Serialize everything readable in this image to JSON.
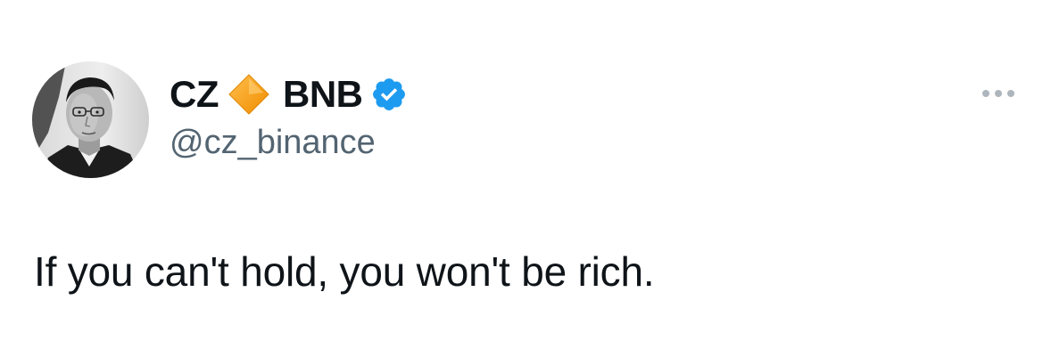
{
  "author": {
    "name": "CZ",
    "name_suffix": "BNB",
    "handle": "@cz_binance",
    "name_emoji": "orange-diamond-icon",
    "verified_badge": "verified-badge-icon",
    "verified_color": "#1d9bf0",
    "diamond_color": "#f5a623"
  },
  "menu": {
    "icon": "more-options-icon"
  },
  "tweet": {
    "text": "If you can't hold, you won't be rich."
  }
}
